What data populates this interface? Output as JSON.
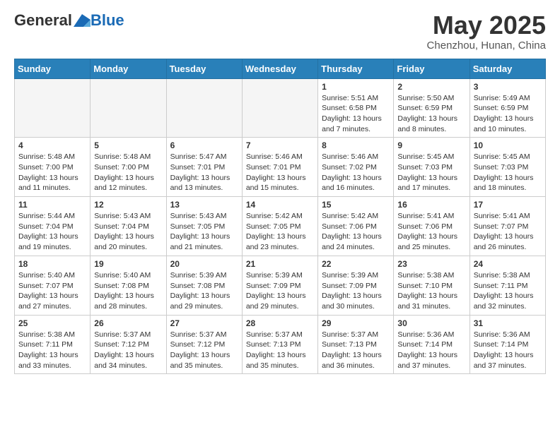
{
  "header": {
    "logo_general": "General",
    "logo_blue": "Blue",
    "month_year": "May 2025",
    "location": "Chenzhou, Hunan, China"
  },
  "days_of_week": [
    "Sunday",
    "Monday",
    "Tuesday",
    "Wednesday",
    "Thursday",
    "Friday",
    "Saturday"
  ],
  "weeks": [
    [
      {
        "num": "",
        "info": ""
      },
      {
        "num": "",
        "info": ""
      },
      {
        "num": "",
        "info": ""
      },
      {
        "num": "",
        "info": ""
      },
      {
        "num": "1",
        "info": "Sunrise: 5:51 AM\nSunset: 6:58 PM\nDaylight: 13 hours\nand 7 minutes."
      },
      {
        "num": "2",
        "info": "Sunrise: 5:50 AM\nSunset: 6:59 PM\nDaylight: 13 hours\nand 8 minutes."
      },
      {
        "num": "3",
        "info": "Sunrise: 5:49 AM\nSunset: 6:59 PM\nDaylight: 13 hours\nand 10 minutes."
      }
    ],
    [
      {
        "num": "4",
        "info": "Sunrise: 5:48 AM\nSunset: 7:00 PM\nDaylight: 13 hours\nand 11 minutes."
      },
      {
        "num": "5",
        "info": "Sunrise: 5:48 AM\nSunset: 7:00 PM\nDaylight: 13 hours\nand 12 minutes."
      },
      {
        "num": "6",
        "info": "Sunrise: 5:47 AM\nSunset: 7:01 PM\nDaylight: 13 hours\nand 13 minutes."
      },
      {
        "num": "7",
        "info": "Sunrise: 5:46 AM\nSunset: 7:01 PM\nDaylight: 13 hours\nand 15 minutes."
      },
      {
        "num": "8",
        "info": "Sunrise: 5:46 AM\nSunset: 7:02 PM\nDaylight: 13 hours\nand 16 minutes."
      },
      {
        "num": "9",
        "info": "Sunrise: 5:45 AM\nSunset: 7:03 PM\nDaylight: 13 hours\nand 17 minutes."
      },
      {
        "num": "10",
        "info": "Sunrise: 5:45 AM\nSunset: 7:03 PM\nDaylight: 13 hours\nand 18 minutes."
      }
    ],
    [
      {
        "num": "11",
        "info": "Sunrise: 5:44 AM\nSunset: 7:04 PM\nDaylight: 13 hours\nand 19 minutes."
      },
      {
        "num": "12",
        "info": "Sunrise: 5:43 AM\nSunset: 7:04 PM\nDaylight: 13 hours\nand 20 minutes."
      },
      {
        "num": "13",
        "info": "Sunrise: 5:43 AM\nSunset: 7:05 PM\nDaylight: 13 hours\nand 21 minutes."
      },
      {
        "num": "14",
        "info": "Sunrise: 5:42 AM\nSunset: 7:05 PM\nDaylight: 13 hours\nand 23 minutes."
      },
      {
        "num": "15",
        "info": "Sunrise: 5:42 AM\nSunset: 7:06 PM\nDaylight: 13 hours\nand 24 minutes."
      },
      {
        "num": "16",
        "info": "Sunrise: 5:41 AM\nSunset: 7:06 PM\nDaylight: 13 hours\nand 25 minutes."
      },
      {
        "num": "17",
        "info": "Sunrise: 5:41 AM\nSunset: 7:07 PM\nDaylight: 13 hours\nand 26 minutes."
      }
    ],
    [
      {
        "num": "18",
        "info": "Sunrise: 5:40 AM\nSunset: 7:07 PM\nDaylight: 13 hours\nand 27 minutes."
      },
      {
        "num": "19",
        "info": "Sunrise: 5:40 AM\nSunset: 7:08 PM\nDaylight: 13 hours\nand 28 minutes."
      },
      {
        "num": "20",
        "info": "Sunrise: 5:39 AM\nSunset: 7:08 PM\nDaylight: 13 hours\nand 29 minutes."
      },
      {
        "num": "21",
        "info": "Sunrise: 5:39 AM\nSunset: 7:09 PM\nDaylight: 13 hours\nand 29 minutes."
      },
      {
        "num": "22",
        "info": "Sunrise: 5:39 AM\nSunset: 7:09 PM\nDaylight: 13 hours\nand 30 minutes."
      },
      {
        "num": "23",
        "info": "Sunrise: 5:38 AM\nSunset: 7:10 PM\nDaylight: 13 hours\nand 31 minutes."
      },
      {
        "num": "24",
        "info": "Sunrise: 5:38 AM\nSunset: 7:11 PM\nDaylight: 13 hours\nand 32 minutes."
      }
    ],
    [
      {
        "num": "25",
        "info": "Sunrise: 5:38 AM\nSunset: 7:11 PM\nDaylight: 13 hours\nand 33 minutes."
      },
      {
        "num": "26",
        "info": "Sunrise: 5:37 AM\nSunset: 7:12 PM\nDaylight: 13 hours\nand 34 minutes."
      },
      {
        "num": "27",
        "info": "Sunrise: 5:37 AM\nSunset: 7:12 PM\nDaylight: 13 hours\nand 35 minutes."
      },
      {
        "num": "28",
        "info": "Sunrise: 5:37 AM\nSunset: 7:13 PM\nDaylight: 13 hours\nand 35 minutes."
      },
      {
        "num": "29",
        "info": "Sunrise: 5:37 AM\nSunset: 7:13 PM\nDaylight: 13 hours\nand 36 minutes."
      },
      {
        "num": "30",
        "info": "Sunrise: 5:36 AM\nSunset: 7:14 PM\nDaylight: 13 hours\nand 37 minutes."
      },
      {
        "num": "31",
        "info": "Sunrise: 5:36 AM\nSunset: 7:14 PM\nDaylight: 13 hours\nand 37 minutes."
      }
    ]
  ]
}
